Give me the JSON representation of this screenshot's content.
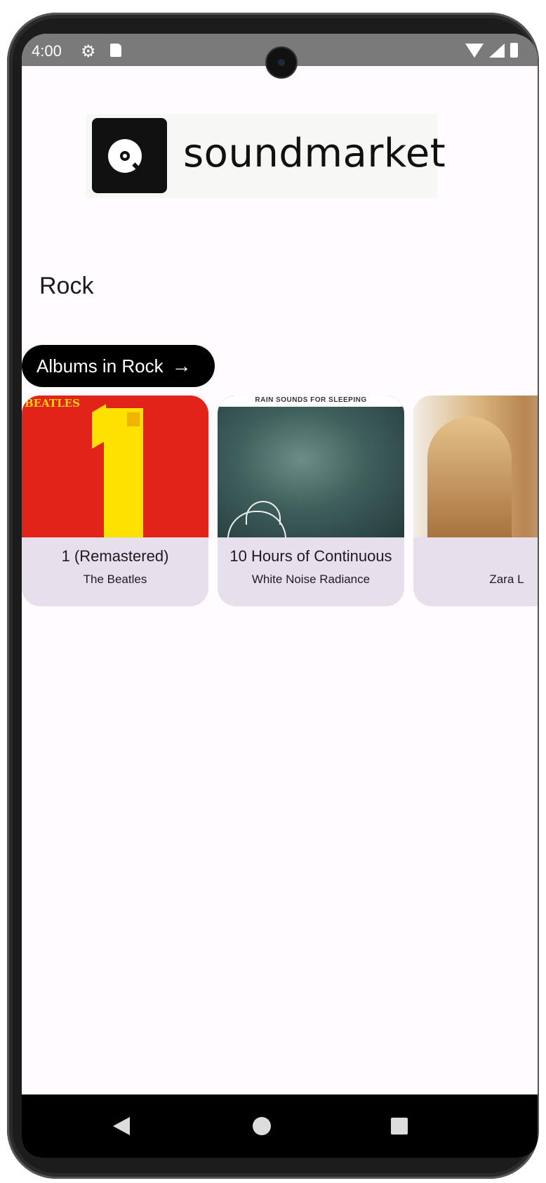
{
  "status_bar": {
    "time": "4:00",
    "icons": [
      "settings-gear-icon",
      "sd-card-icon",
      "wifi-icon",
      "cell-signal-icon",
      "battery-icon"
    ]
  },
  "header": {
    "logo_text": "soundmarket",
    "logo_icon": "vinyl-disc-icon"
  },
  "genre": {
    "title": "Rock",
    "albums_button_label": "Albums in Rock",
    "albums_button_icon": "arrow-right-icon"
  },
  "albums": [
    {
      "title": "1 (Remastered)",
      "artist": "The Beatles",
      "art_text": "BEATLES"
    },
    {
      "title": "10 Hours of Continuous",
      "artist": "White Noise Radiance",
      "art_text": "RAIN SOUNDS FOR SLEEPING"
    },
    {
      "title": "",
      "artist": "Zara L"
    }
  ],
  "navigation": {
    "back_icon": "nav-back-icon",
    "home_icon": "nav-home-icon",
    "recents_icon": "nav-recents-icon"
  },
  "colors": {
    "background": "#fffbfe",
    "card": "#e7e0ec",
    "button": "#000000",
    "status_bar": "#7a7a7a"
  }
}
